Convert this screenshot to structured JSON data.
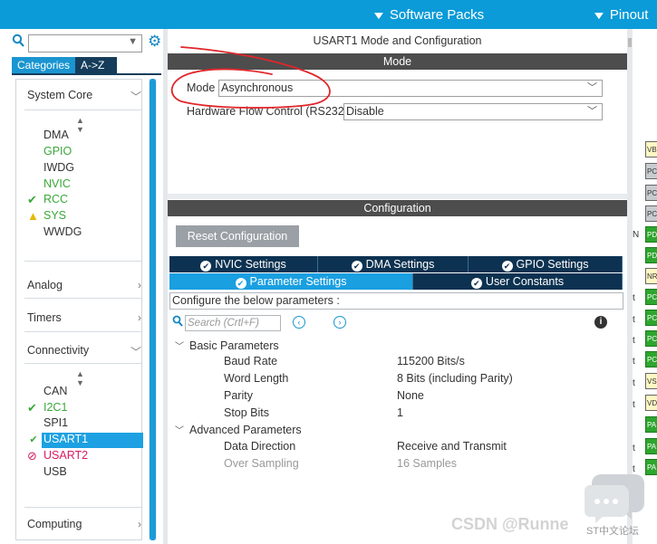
{
  "topbar": {
    "software_packs": "Software Packs",
    "pinout": "Pinout"
  },
  "sidebar": {
    "search_value": "",
    "tabs": {
      "categories": "Categories",
      "atoz": "A->Z"
    },
    "system_core": {
      "label": "System Core",
      "items": [
        {
          "label": "DMA",
          "state": "normal"
        },
        {
          "label": "GPIO",
          "state": "green"
        },
        {
          "label": "IWDG",
          "state": "normal"
        },
        {
          "label": "NVIC",
          "state": "green"
        },
        {
          "label": "RCC",
          "state": "checked"
        },
        {
          "label": "SYS",
          "state": "warning"
        },
        {
          "label": "WWDG",
          "state": "normal"
        }
      ]
    },
    "analog": "Analog",
    "timers": "Timers",
    "connectivity": {
      "label": "Connectivity",
      "items": [
        {
          "label": "CAN",
          "state": "normal"
        },
        {
          "label": "I2C1",
          "state": "checked"
        },
        {
          "label": "SPI1",
          "state": "normal"
        },
        {
          "label": "USART1",
          "state": "selected"
        },
        {
          "label": "USART2",
          "state": "disabled"
        },
        {
          "label": "USB",
          "state": "normal"
        }
      ]
    },
    "computing": "Computing"
  },
  "main": {
    "title": "USART1 Mode and Configuration",
    "mode_bar": "Mode",
    "mode_label": "Mode",
    "mode_value": "Asynchronous",
    "hw_flow_label": "Hardware Flow Control (RS232)",
    "hw_flow_value": "Disable",
    "config_bar": "Configuration",
    "reset_button": "Reset Configuration",
    "tabs": {
      "nvic": "NVIC Settings",
      "dma": "DMA Settings",
      "gpio": "GPIO Settings",
      "params": "Parameter Settings",
      "user_constants": "User Constants"
    },
    "config_desc": "Configure the below parameters :",
    "search_placeholder": "Search (Crtl+F)",
    "basic_group": "Basic Parameters",
    "basic": [
      {
        "label": "Baud Rate",
        "value": "115200 Bits/s"
      },
      {
        "label": "Word Length",
        "value": "8 Bits (including Parity)"
      },
      {
        "label": "Parity",
        "value": "None"
      },
      {
        "label": "Stop Bits",
        "value": "1"
      }
    ],
    "advanced_group": "Advanced Parameters",
    "advanced": [
      {
        "label": "Data Direction",
        "value": "Receive and Transmit"
      },
      {
        "label": "Over Sampling",
        "value": "16 Samples"
      }
    ]
  },
  "pin_strip": {
    "pins": [
      "VB",
      "PC",
      "PC",
      "PC",
      "PD",
      "PD",
      "NR",
      "PC",
      "PC",
      "PC",
      "PC",
      "VS",
      "VD",
      "PA",
      "PA",
      "PA"
    ],
    "letters": [
      "N",
      "t",
      "t",
      "t",
      "t",
      "t",
      "t",
      "t",
      "t"
    ]
  },
  "watermark": {
    "text": "CSDN @Runne",
    "logo_text": "ST中文论坛"
  },
  "colors": {
    "topbar": "#0b9bd8",
    "dark_bar": "#4d4d4d",
    "tab_dark": "#0d3251",
    "tab_active": "#1a9fe0",
    "green": "#3aa83a",
    "annotation_red": "#e0262b"
  }
}
